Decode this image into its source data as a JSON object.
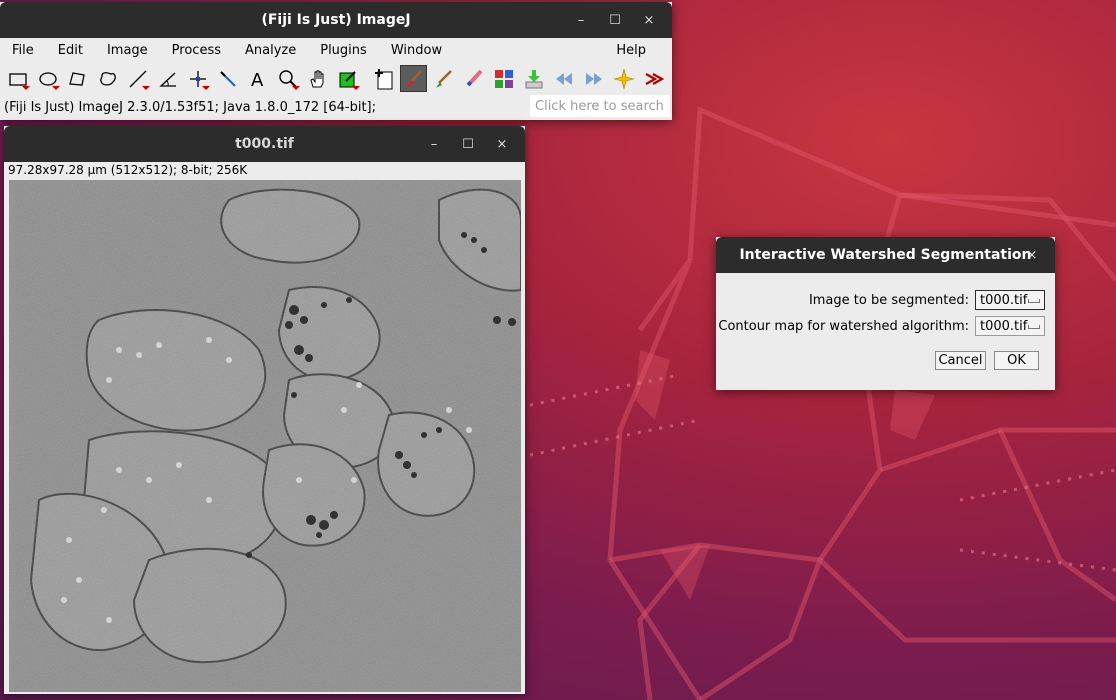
{
  "main_window": {
    "title": "(Fiji Is Just) ImageJ",
    "controls": {
      "minimize": "–",
      "maximize": "☐",
      "close": "×"
    },
    "menus": [
      "File",
      "Edit",
      "Image",
      "Process",
      "Analyze",
      "Plugins",
      "Window"
    ],
    "help_menu": "Help",
    "tools": [
      "rectangle-tool",
      "oval-tool",
      "polygon-tool",
      "freehand-tool",
      "line-tool",
      "angle-tool",
      "point-tool",
      "wand-tool",
      "text-tool",
      "magnifier-tool",
      "hand-tool",
      "color-picker-tool",
      "new-image-tool",
      "brush-tool",
      "pencil-tool",
      "eraser-tool",
      "lut-tool",
      "update-tool",
      "rewind-tool",
      "forward-tool",
      "sparkle-tool",
      "more-tools"
    ],
    "status_text": "(Fiji Is Just) ImageJ 2.3.0/1.53f51; Java 1.8.0_172 [64-bit];",
    "search_placeholder": "Click here to search"
  },
  "image_window": {
    "title": "t000.tif",
    "info": "97.28x97.28 µm (512x512); 8-bit; 256K",
    "controls": {
      "minimize": "–",
      "maximize": "☐",
      "close": "×"
    }
  },
  "dialog": {
    "title": "Interactive Watershed Segmentation",
    "close": "×",
    "fields": [
      {
        "label": "Image to be segmented:",
        "value": "t000.tif"
      },
      {
        "label": "Contour map for watershed algorithm:",
        "value": "t000.tif"
      }
    ],
    "cancel_label": "Cancel",
    "ok_label": "OK"
  },
  "colors": {
    "titlebar": "#2c2c2c",
    "window_bg": "#ececec",
    "wallpaper_accent": "#c8363f",
    "wallpaper_dark": "#5b1a50"
  }
}
